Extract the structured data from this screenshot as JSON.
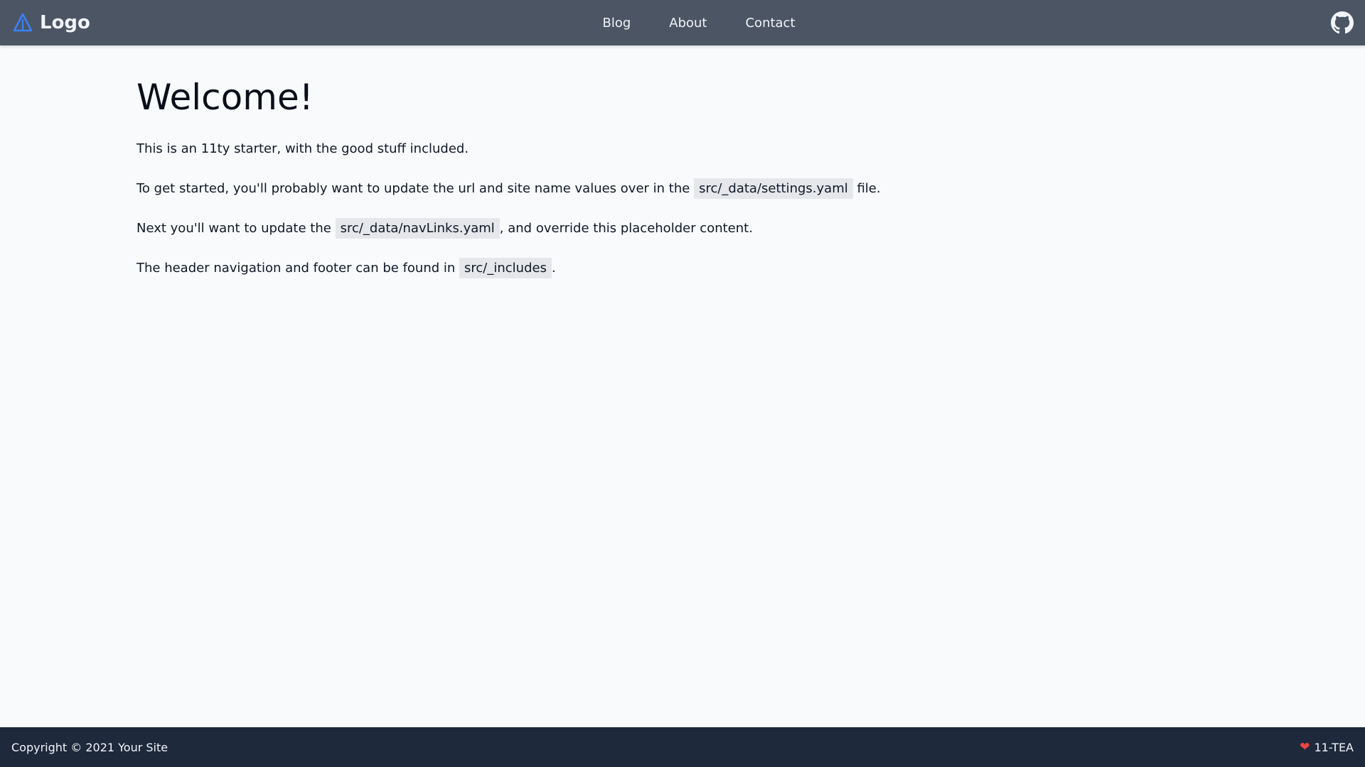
{
  "header": {
    "brand_label": "Logo",
    "nav": [
      {
        "label": "Blog"
      },
      {
        "label": "About"
      },
      {
        "label": "Contact"
      }
    ],
    "github_icon": "github-icon",
    "logo_icon": "triangle-logo-icon",
    "accent": "#3b82f6"
  },
  "main": {
    "title": "Welcome!",
    "p1": "This is an 11ty starter, with the good stuff included.",
    "p2_before": "To get started, you'll probably want to update the url and site name values over in the",
    "p2_code": "src/_data/settings.yaml",
    "p2_after": "file.",
    "p3_before": "Next you'll want to update the",
    "p3_code": "src/_data/navLinks.yaml",
    "p3_after": ", and override this placeholder content.",
    "p4_before": "The header navigation and footer can be found in",
    "p4_code": "src/_includes",
    "p4_after": "."
  },
  "footer": {
    "copyright": "Copyright © 2021 Your Site",
    "credit": "11-TEA",
    "credit_icon": "heart-icon"
  },
  "colors": {
    "header_bg": "#4b5563",
    "footer_bg": "#1e293b",
    "page_bg": "#f8fafc",
    "code_bg": "#e5e7eb"
  }
}
